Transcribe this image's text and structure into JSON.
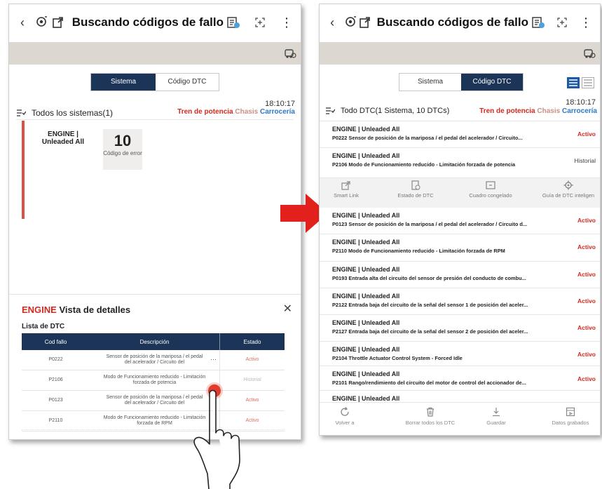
{
  "header": {
    "title": "Buscando códigos de fallo",
    "back_icon": "back-chevron-icon",
    "right_icons": [
      "report-icon",
      "expand-icon",
      "more-icon"
    ]
  },
  "colors": {
    "navy": "#1c3457",
    "red": "#d22a1f",
    "card_bar": "#d95247",
    "beige": "#ddd7d1",
    "arrow": "#e2211c"
  },
  "left": {
    "tabs": {
      "sistema": "Sistema",
      "codigo": "Código DTC"
    },
    "time": "18:10:17",
    "all_systems": "Todos los sistemas(1)",
    "categories": [
      "Tren de potencia",
      "Chasis",
      "Carrocería"
    ],
    "engine_card": {
      "name": "ENGINE | Unleaded All",
      "count": "10",
      "count_label": "Código de error"
    },
    "details": {
      "title_prefix": "ENGINE",
      "title_rest": "Vista de detalles",
      "close": "✕",
      "list_label": "Lista de DTC",
      "columns": [
        "Cod fallo",
        "Descripción",
        "Estado"
      ],
      "rows": [
        {
          "code": "P0222",
          "desc": "Sensor de posición de la mariposa / el pedal del acelerador / Circuito del",
          "more": "···",
          "status": "Activo"
        },
        {
          "code": "P2106",
          "desc": "Modo de Funcionamiento reducido - Limitación forzada de potencia",
          "more": "",
          "status": "Historial"
        },
        {
          "code": "P0123",
          "desc": "Sensor de posición de la mariposa / el pedal del acelerador / Circuito del",
          "more": "",
          "status": "Activo"
        },
        {
          "code": "P2110",
          "desc": "Modo de Funcionamiento reducido - Limitación forzada de RPM",
          "more": "",
          "status": "Activo"
        }
      ]
    }
  },
  "right": {
    "tabs": {
      "sistema": "Sistema",
      "codigo": "Código DTC"
    },
    "time": "18:10:17",
    "summary": "Todo DTC(1 Sistema, 10 DTCs)",
    "categories": [
      "Tren de potencia",
      "Chasis",
      "Carrocería"
    ],
    "rows": [
      {
        "ecu": "ENGINE | Unleaded All",
        "desc": "P0222 Sensor de posición de la mariposa / el pedal del acelerador / Circuito...",
        "status": "Activo"
      },
      {
        "ecu": "ENGINE | Unleaded All",
        "desc": "P2106 Modo de Funcionamiento reducido - Limitación forzada de potencia",
        "status": "Historial"
      },
      {
        "ecu": "ENGINE | Unleaded All",
        "desc": "P0123 Sensor de posición de la mariposa / el pedal del acelerador / Circuito d...",
        "status": "Activo"
      },
      {
        "ecu": "ENGINE | Unleaded All",
        "desc": "P2110 Modo de Funcionamiento reducido - Limitación forzada de RPM",
        "status": "Activo"
      },
      {
        "ecu": "ENGINE | Unleaded All",
        "desc": "P0193 Entrada alta del circuito del sensor de presión del conducto de combu...",
        "status": "Activo"
      },
      {
        "ecu": "ENGINE | Unleaded All",
        "desc": "P2122 Entrada baja del circuito de la señal del sensor 1 de posición del aceler...",
        "status": "Activo"
      },
      {
        "ecu": "ENGINE | Unleaded All",
        "desc": "P2127 Entrada baja del circuito de la señal del sensor 2 de posición del aceler...",
        "status": "Activo"
      },
      {
        "ecu": "ENGINE | Unleaded All",
        "desc": "P2104 Throttle Actuator Control System - Forced Idle",
        "status": "Activo"
      },
      {
        "ecu": "ENGINE | Unleaded All",
        "desc": "P2101 Rango/rendimiento del circuito del motor de control del accionador de...",
        "status": "Activo"
      },
      {
        "ecu": "ENGINE | Unleaded All",
        "desc": "",
        "status": ""
      }
    ],
    "actions": [
      "Smart Link",
      "Estado de DTC",
      "Cuadro congelado",
      "Guía de DTC inteligen"
    ],
    "bottom": [
      "Volver a",
      "Borrar todos los DTC",
      "Guardar",
      "Datos grabados"
    ]
  }
}
